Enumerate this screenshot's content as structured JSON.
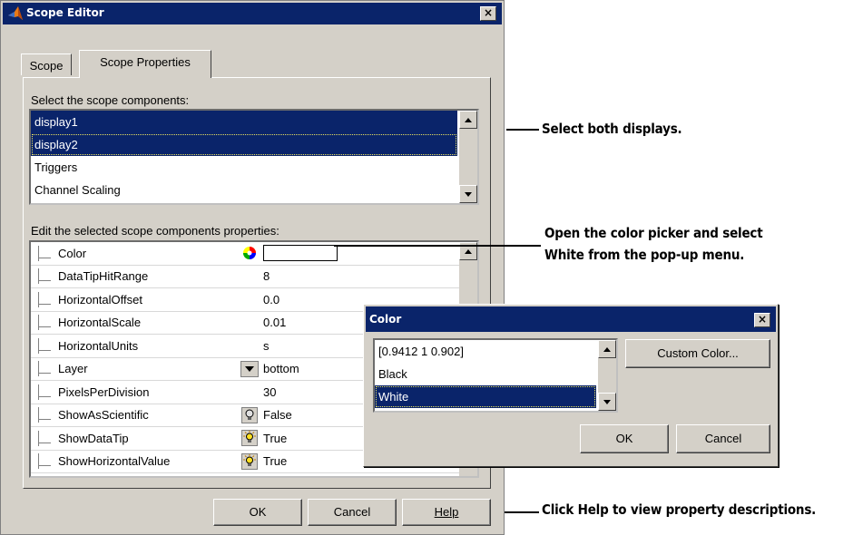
{
  "editor": {
    "title": "Scope Editor",
    "close_glyph": "×",
    "tabs": [
      {
        "label": "Scope"
      },
      {
        "label": "Scope Properties"
      }
    ],
    "components_label": "Select the scope components:",
    "components": [
      {
        "label": "display1",
        "selected": true
      },
      {
        "label": "display2",
        "selected": true
      },
      {
        "label": "Triggers",
        "selected": false
      },
      {
        "label": "Channel Scaling",
        "selected": false
      }
    ],
    "properties_label": "Edit the selected scope components properties:",
    "properties": [
      {
        "name": "Color",
        "value": "",
        "icon": "color-wheel-icon"
      },
      {
        "name": "DataTipHitRange",
        "value": "8",
        "icon": ""
      },
      {
        "name": "HorizontalOffset",
        "value": "0.0",
        "icon": ""
      },
      {
        "name": "HorizontalScale",
        "value": "0.01",
        "icon": ""
      },
      {
        "name": "HorizontalUnits",
        "value": "s",
        "icon": ""
      },
      {
        "name": "Layer",
        "value": "bottom",
        "icon": "dropdown-arrow-icon"
      },
      {
        "name": "PixelsPerDivision",
        "value": "30",
        "icon": ""
      },
      {
        "name": "ShowAsScientific",
        "value": "False",
        "icon": "lightbulb-off-icon"
      },
      {
        "name": "ShowDataTip",
        "value": "True",
        "icon": "lightbulb-on-icon"
      },
      {
        "name": "ShowHorizontalValue",
        "value": "True",
        "icon": "lightbulb-on-icon"
      }
    ],
    "buttons": {
      "ok": "OK",
      "cancel": "Cancel",
      "help": "Help"
    }
  },
  "color_dialog": {
    "title": "Color",
    "close_glyph": "×",
    "options": [
      {
        "label": "[0.9412 1 0.902]",
        "selected": false
      },
      {
        "label": "Black",
        "selected": false
      },
      {
        "label": "White",
        "selected": true
      }
    ],
    "custom_button": "Custom Color...",
    "ok": "OK",
    "cancel": "Cancel"
  },
  "annotations": {
    "select_displays": "Select both displays.",
    "color_picker_line1": "Open the color picker and select",
    "color_picker_line2": "White from the pop-up menu.",
    "help_note": "Click Help to view property descriptions."
  },
  "colors": {
    "titlebar": "#0a246a",
    "selection": "#0a246a",
    "dialog_bg": "#d4d0c8"
  }
}
